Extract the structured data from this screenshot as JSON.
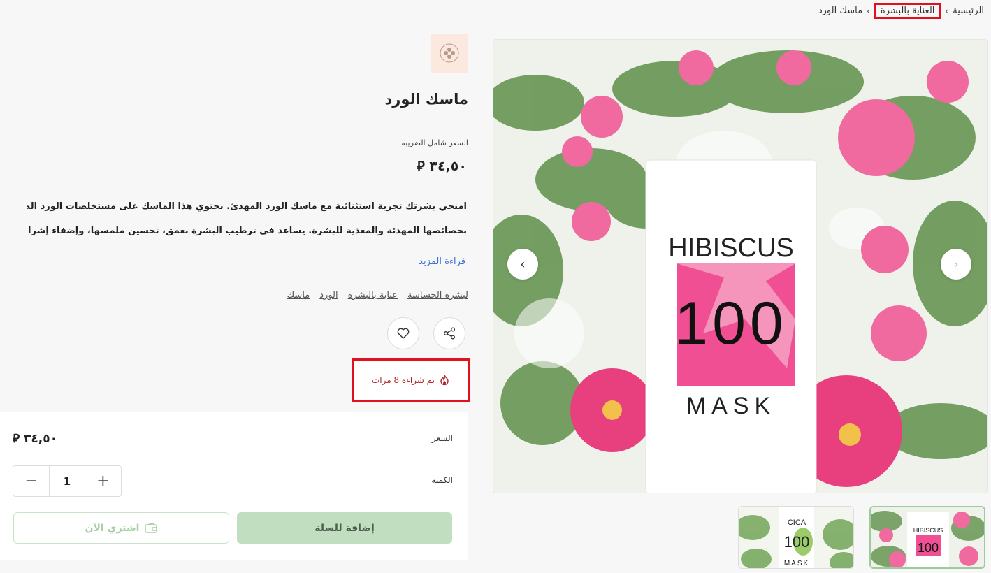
{
  "breadcrumb": {
    "home": "الرئيسية",
    "category": "العناية بالبشرة",
    "current": "ماسك الورد",
    "separator": "‹"
  },
  "product": {
    "title": "ماسك الورد",
    "tax_note": "السعر شامل الضريبه",
    "price": "٣٤,٥٠",
    "currency_symbol": "⃁",
    "description_line1": "امنحي بشرتك تجربة استثنائية مع ماسك الورد المهدئ. يحتوي هذا الماسك على مستخلصات الورد الطبيعية المعروفة",
    "description_line2": "بخصائصها المهدئة والمغذية للبشرة. يساعد في ترطيب البشرة بعمق، تحسين ملمسها، وإضفاء إشراقة طبيعية. بفضل",
    "read_more": "قراءة المزيد",
    "tags": [
      "لبشرة الحساسة",
      "عناية بالبشرة",
      "الورد",
      "ماسك"
    ],
    "sold_count_text": "تم شراءه 8 مرات"
  },
  "gallery": {
    "image_main_text_top": "HIBISCUS",
    "image_main_text_mid": "100",
    "image_main_text_bottom": "MASK",
    "thumb1_top": "HIBISCUS",
    "thumb1_mid": "100",
    "thumb2_top": "CICA",
    "thumb2_mid": "100",
    "thumb2_bottom": "MASK",
    "prev_arrow": "‹",
    "next_arrow": "›"
  },
  "purchase": {
    "price_label": "السعر",
    "price": "٣٤,٥٠",
    "quantity_label": "الكمية",
    "quantity": "1",
    "minus": "−",
    "plus": "+",
    "add_to_cart": "إضافة للسلة",
    "buy_now": "اشتري الآن"
  },
  "colors": {
    "accent_green": "#c1dfc0",
    "highlight_red": "#e0101e",
    "link_blue": "#3a6fd8",
    "sold_red": "#b22222"
  }
}
